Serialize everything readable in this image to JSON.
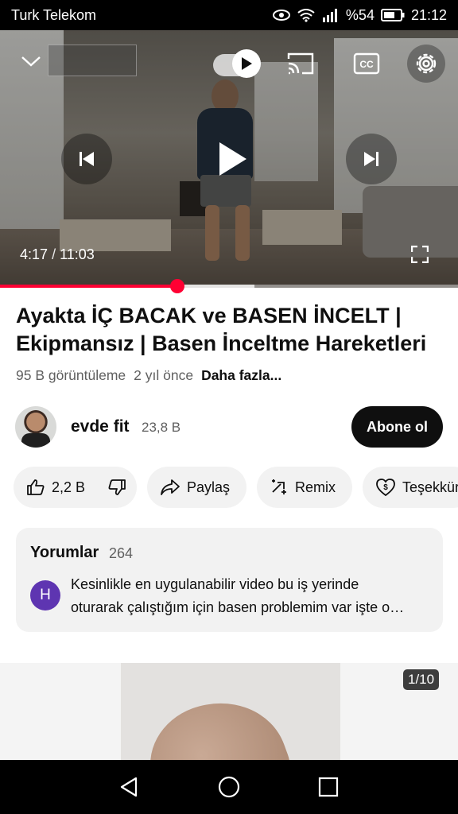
{
  "status_bar": {
    "carrier": "Turk Telekom",
    "battery": "%54",
    "time": "21:12",
    "icons": [
      "eye-icon",
      "wifi-icon",
      "signal-icon",
      "battery-icon"
    ]
  },
  "player": {
    "current_time": "4:17",
    "separator": "/",
    "duration": "11:03",
    "progress_fraction": 0.387,
    "buffered_fraction": 0.555,
    "icons": [
      "chevron-down-icon",
      "autoplay-toggle-icon",
      "cast-icon",
      "cc-icon",
      "settings-icon",
      "previous-icon",
      "play-icon",
      "next-icon",
      "fullscreen-icon"
    ]
  },
  "video": {
    "title": "Ayakta İÇ BACAK ve BASEN İNCELT | Ekipmansız | Basen İnceltme Hareketleri",
    "views": "95 B görüntüleme",
    "age": "2 yıl önce",
    "more": "Daha fazla..."
  },
  "channel": {
    "name": "evde fit",
    "subscribers": "23,8 B",
    "subscribe_label": "Abone ol"
  },
  "actions": {
    "likes": "2,2 B",
    "share": "Paylaş",
    "remix": "Remix",
    "thanks": "Teşekkür"
  },
  "comments": {
    "title": "Yorumlar",
    "count": "264",
    "avatar_letter": "H",
    "line1": "Kesinlikle en uygulanabilir video bu iş yerinde",
    "line2": "oturarak çalıştığım için basen problemim var işte o…"
  },
  "shelf": {
    "counter": "1/10"
  },
  "colors": {
    "accent": "#ff0033",
    "chip_bg": "#f2f2f2",
    "subscribe_bg": "#0f0f0f",
    "comment_avatar": "#5e35b1"
  }
}
